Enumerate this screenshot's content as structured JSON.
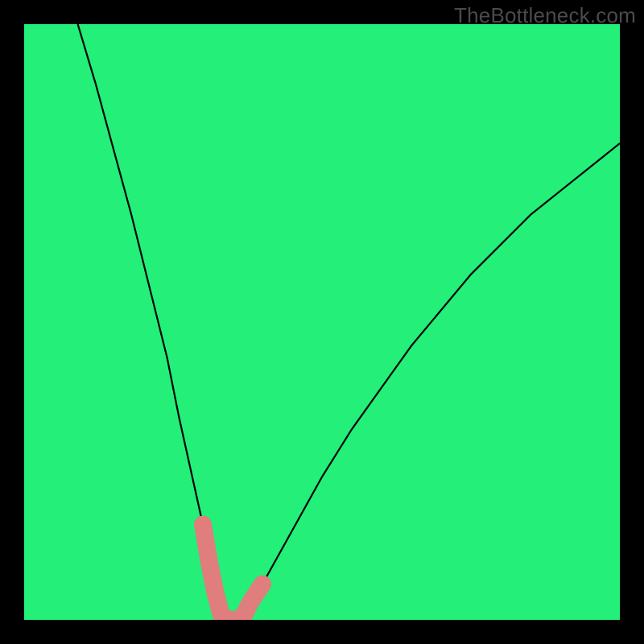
{
  "watermark": "TheBottleneck.com",
  "colors": {
    "bg_top": "#ff1a54",
    "bg_mid1": "#ff8a1e",
    "bg_mid2": "#ffe91a",
    "bg_light": "#ffffb5",
    "bg_green": "#23ef79",
    "curve": "#000000",
    "marker": "#e07d7d",
    "frame": "#000000"
  },
  "chart_data": {
    "type": "line",
    "title": "",
    "xlabel": "",
    "ylabel": "",
    "xlim": [
      0,
      100
    ],
    "ylim": [
      0,
      100
    ],
    "series": [
      {
        "name": "bottleneck-curve",
        "x": [
          9,
          12,
          15,
          18,
          21,
          24,
          26,
          28,
          30,
          31,
          32,
          33,
          34,
          35,
          36,
          37,
          40,
          45,
          50,
          55,
          60,
          65,
          70,
          75,
          80,
          85,
          90,
          95,
          100
        ],
        "y": [
          100,
          90,
          79,
          68,
          56,
          44,
          34,
          25,
          16,
          10,
          5,
          1,
          0,
          0,
          0,
          1,
          6,
          15,
          24,
          32,
          39,
          46,
          52,
          58,
          63,
          68,
          72,
          76,
          80
        ]
      }
    ],
    "highlight_segments": [
      {
        "name": "left-branch",
        "x": [
          30,
          31,
          32,
          33
        ],
        "y": [
          16,
          10,
          5,
          1
        ]
      },
      {
        "name": "floor",
        "x": [
          33,
          34,
          35,
          36,
          37
        ],
        "y": [
          1,
          0,
          0,
          0,
          1
        ]
      },
      {
        "name": "right-branch",
        "x": [
          37,
          38,
          39,
          40
        ],
        "y": [
          1,
          3,
          4.5,
          6
        ]
      }
    ],
    "gradient_bands": [
      {
        "y": 0,
        "color": "#23ef79"
      },
      {
        "y": 2,
        "color": "#8bf58a"
      },
      {
        "y": 4,
        "color": "#e0fa9f"
      },
      {
        "y": 8,
        "color": "#ffffb5"
      },
      {
        "y": 20,
        "color": "#ffe91a"
      },
      {
        "y": 50,
        "color": "#ff8a1e"
      },
      {
        "y": 100,
        "color": "#ff1a54"
      }
    ]
  }
}
